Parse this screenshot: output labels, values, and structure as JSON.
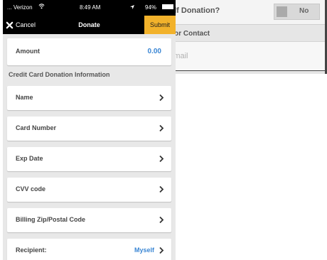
{
  "background_screen": {
    "self_donation_label": "elf Donation?",
    "self_donation_toggle": "No",
    "section_label": "nor Contact",
    "email_placeholder": "Email"
  },
  "status_bar": {
    "carrier": "... Verizon",
    "time": "8:49 AM",
    "battery": "94%"
  },
  "nav": {
    "cancel_label": "Cancel",
    "title": "Donate",
    "submit_label": "Submit"
  },
  "form": {
    "amount_label": "Amount",
    "amount_value": "0.00",
    "cc_section_title": "Credit Card Donation Information",
    "fields": [
      {
        "label": "Name"
      },
      {
        "label": "Card Number"
      },
      {
        "label": "Exp Date"
      },
      {
        "label": "CVV code"
      },
      {
        "label": "Billing Zip/Postal Code"
      }
    ],
    "recipient_label": "Recipient:",
    "recipient_value": "Myself"
  },
  "colors": {
    "accent_blue": "#3a86d4",
    "submit_yellow": "#f2b22b",
    "nav_black": "#000000"
  },
  "icons": {
    "cancel": "close-icon",
    "row_action": "chevron-right-icon",
    "wifi": "wifi-icon",
    "battery": "battery-icon",
    "location": "location-arrow-icon"
  }
}
